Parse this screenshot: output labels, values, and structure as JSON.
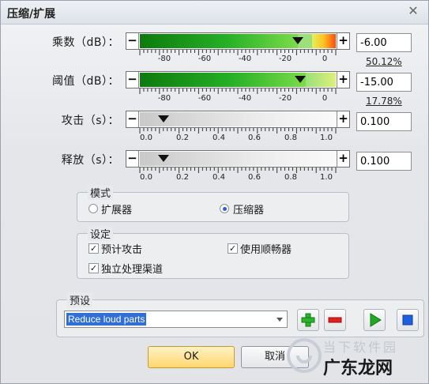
{
  "window": {
    "title": "压缩/扩展"
  },
  "rows": {
    "gain": {
      "label": "乘数（dB）：",
      "value": "-6.00",
      "percent": "50.12%",
      "ticks": [
        "-80",
        "-60",
        "-40",
        "-20",
        "0"
      ]
    },
    "threshold": {
      "label": "阈值（dB）：",
      "value": "-15.00",
      "percent": "17.78%",
      "ticks": [
        "-80",
        "-60",
        "-40",
        "-20",
        "0"
      ]
    },
    "attack": {
      "label": "攻击（s）：",
      "value": "0.100",
      "ticks": [
        "0.0",
        "0.2",
        "0.4",
        "0.6",
        "0.8",
        "1.0"
      ]
    },
    "release": {
      "label": "释放（s）：",
      "value": "0.100",
      "ticks": [
        "0.0",
        "0.2",
        "0.4",
        "0.6",
        "0.8",
        "1.0"
      ]
    }
  },
  "mode": {
    "title": "模式",
    "options": [
      "扩展器",
      "压缩器"
    ],
    "selected": "压缩器"
  },
  "settings": {
    "title": "设定",
    "options": [
      {
        "label": "预计攻击",
        "checked": true
      },
      {
        "label": "使用顺畅器",
        "checked": true
      },
      {
        "label": "独立处理渠道",
        "checked": true
      }
    ]
  },
  "preset": {
    "title": "预设",
    "value": "Reduce loud parts"
  },
  "buttons": {
    "ok": "OK",
    "cancel": "取消"
  },
  "watermark": {
    "line1": "当下软件园",
    "line2": "广东龙网"
  },
  "colors": {
    "accent": "#2f6fd6",
    "ok_button": "#ffd66e",
    "add": "#2bb32b",
    "remove": "#e02020",
    "play": "#23a823",
    "stop": "#1c5fe0"
  }
}
